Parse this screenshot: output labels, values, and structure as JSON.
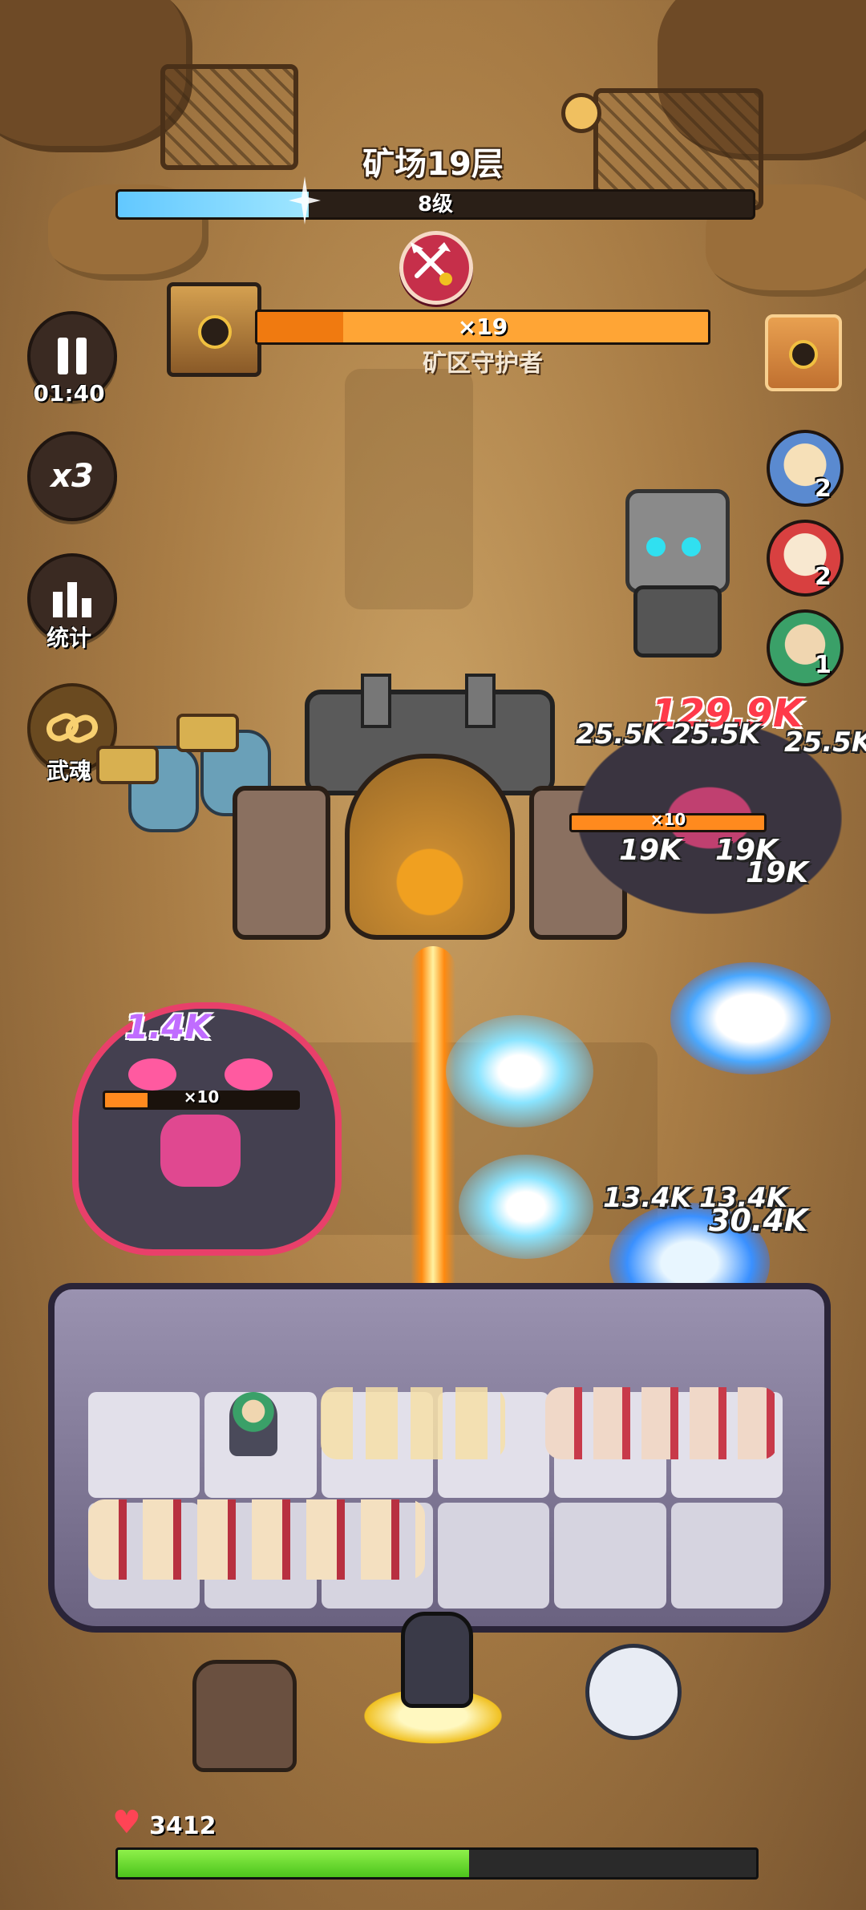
{
  "stage": {
    "title": "矿场19层",
    "level_label": "8级",
    "xp_progress": 0.3
  },
  "boss": {
    "hp_multiplier": "×19",
    "name": "矿区守护者",
    "hp_progress": 1.0,
    "hp_layer_progress": 0.19
  },
  "controls": {
    "pause_timer": "01:40",
    "speed_label": "x3",
    "stats_label": "统计",
    "soul_label": "武魂"
  },
  "heroes": [
    {
      "name": "hero-blonde",
      "count": "2"
    },
    {
      "name": "hero-clown",
      "count": "2"
    },
    {
      "name": "hero-green",
      "count": "1"
    }
  ],
  "enemies": [
    {
      "name": "elite-right",
      "hp_multiplier": "×10",
      "hp_progress": 1.0
    },
    {
      "name": "elite-left",
      "hp_multiplier": "×10",
      "hp_progress": 0.22
    }
  ],
  "damage_numbers": [
    "129.9K",
    "25.5K",
    "25.5K",
    "25.5K",
    "19K",
    "19K",
    "19K",
    "1.4K",
    "13.4K",
    "13.4K",
    "30.4K"
  ],
  "base": {
    "hp": "3412",
    "hp_progress": 0.55
  },
  "colors": {
    "xp": "#62c8ff",
    "boss_hp": "#f07a10",
    "base_hp": "#4cc41c",
    "crit": "#ff3a4a"
  }
}
